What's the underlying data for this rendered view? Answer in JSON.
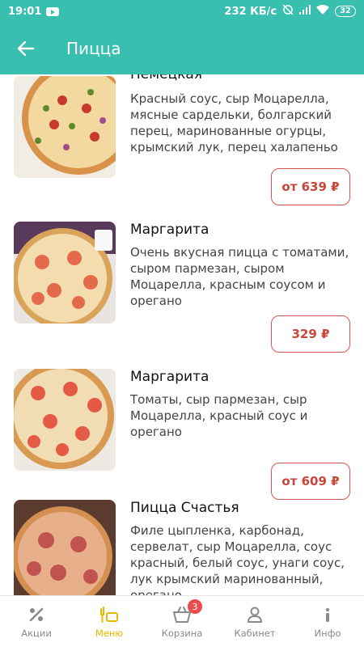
{
  "status_bar": {
    "time": "19:01",
    "network_speed": "232 КБ/с",
    "battery": "32"
  },
  "app_bar": {
    "title": "Пицца"
  },
  "menu": {
    "items": [
      {
        "name": "Немецкая",
        "description": "Красный соус, сыр Моцарелла, мясные сардельки, болгарский перец, маринованные огурцы, крымский лук, перец халапеньо",
        "price": "от 639 ₽"
      },
      {
        "name": "Маргарита",
        "description": "Очень вкусная пицца с томатами, сыром пармезан, сыром Моцарелла, красным соусом и орегано",
        "price": "329 ₽"
      },
      {
        "name": "Маргарита",
        "description": "Томаты, сыр пармезан, сыр Моцарелла, красный соус и орегано",
        "price": "от 609 ₽"
      },
      {
        "name": "Пицца Счастья",
        "description": "Филе цыпленка, карбонад, сервелат, сыр Моцарелла, соус красный, белый соус, унаги соус, лук крымский маринованный, орегано",
        "price": ""
      }
    ]
  },
  "bottom_nav": {
    "items": [
      {
        "label": "Акции",
        "icon": "percent-icon"
      },
      {
        "label": "Меню",
        "icon": "menu-food-icon"
      },
      {
        "label": "Корзина",
        "icon": "basket-icon",
        "badge": "3"
      },
      {
        "label": "Кабинет",
        "icon": "user-icon"
      },
      {
        "label": "Инфо",
        "icon": "info-icon"
      }
    ],
    "active": "Меню"
  },
  "colors": {
    "primary": "#39bfb0",
    "accent_price": "#c9463c",
    "active_nav": "#e8b800"
  }
}
